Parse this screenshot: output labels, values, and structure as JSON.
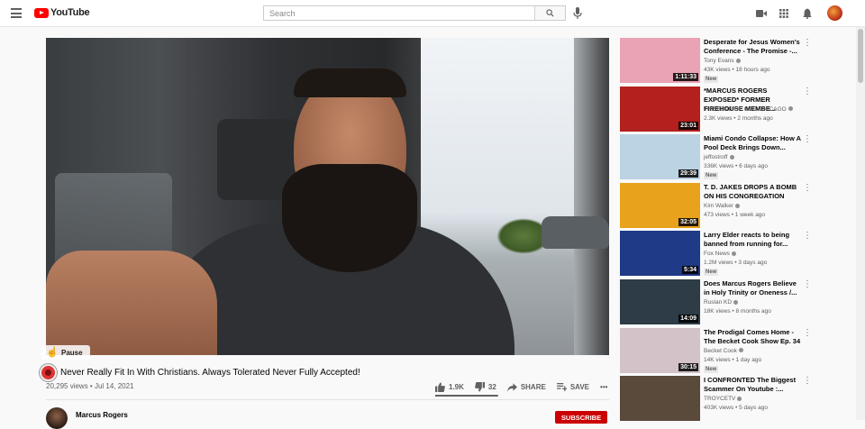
{
  "header": {
    "logo_text": "YouTube",
    "search_placeholder": "Search"
  },
  "player": {
    "pause_tooltip": "Pause"
  },
  "video": {
    "title": "Never Really Fit In With Christians. Always Tolerated Never Fully Accepted!",
    "views_date": "20,295 views • Jul 14, 2021",
    "likes": "1.9K",
    "dislikes": "32",
    "like_ratio": 0.983,
    "share_label": "SHARE",
    "save_label": "SAVE",
    "more_label": "•••",
    "channel": "Marcus Rogers",
    "subscribe_label": "SUBSCRIBE"
  },
  "recommendations": [
    {
      "title": "Desperate for Jesus Women's Conference - The Promise -...",
      "channel": "Tony Evans",
      "stats": "43K views • 18 hours ago",
      "badge": "New",
      "duration": "1:11:33",
      "thumb_color": "#e9a3b4"
    },
    {
      "title": "*MARCUS ROGERS EXPOSED* FORMER FIREHOUSE MEMBE...",
      "channel": "THE FEAR OF GOD CHICAGO",
      "stats": "2.3K views • 2 months ago",
      "badge": "",
      "duration": "23:01",
      "thumb_color": "#b3201d"
    },
    {
      "title": "Miami Condo Collapse: How A Pool Deck Brings Down...",
      "channel": "jeffostroff",
      "stats": "336K views • 6 days ago",
      "badge": "New",
      "duration": "29:39",
      "thumb_color": "#bcd3e3"
    },
    {
      "title": "T. D. JAKES DROPS A BOMB ON HIS CONGREGATION",
      "channel": "Kim Walker",
      "stats": "473 views • 1 week ago",
      "badge": "",
      "duration": "32:05",
      "thumb_color": "#e8a21b"
    },
    {
      "title": "Larry Elder reacts to being banned from running for...",
      "channel": "Fox News",
      "stats": "1.2M views • 3 days ago",
      "badge": "New",
      "duration": "5:34",
      "thumb_color": "#1f3a86"
    },
    {
      "title": "Does Marcus Rogers Believe in Holy Trinity or Oneness /...",
      "channel": "Ruslan KD",
      "stats": "18K views • 8 months ago",
      "badge": "",
      "duration": "14:09",
      "thumb_color": "#2d3c46"
    },
    {
      "title": "The Prodigal Comes Home - The Becket Cook Show Ep. 34",
      "channel": "Becket Cook",
      "stats": "14K views • 1 day ago",
      "badge": "New",
      "duration": "30:15",
      "thumb_color": "#d3c2c8"
    },
    {
      "title": "I CONFRONTED The Biggest Scammer On Youtube :...",
      "channel": "TROYCETV",
      "stats": "403K views • 5 days ago",
      "badge": "",
      "duration": "",
      "thumb_color": "#5a4a3c"
    }
  ]
}
